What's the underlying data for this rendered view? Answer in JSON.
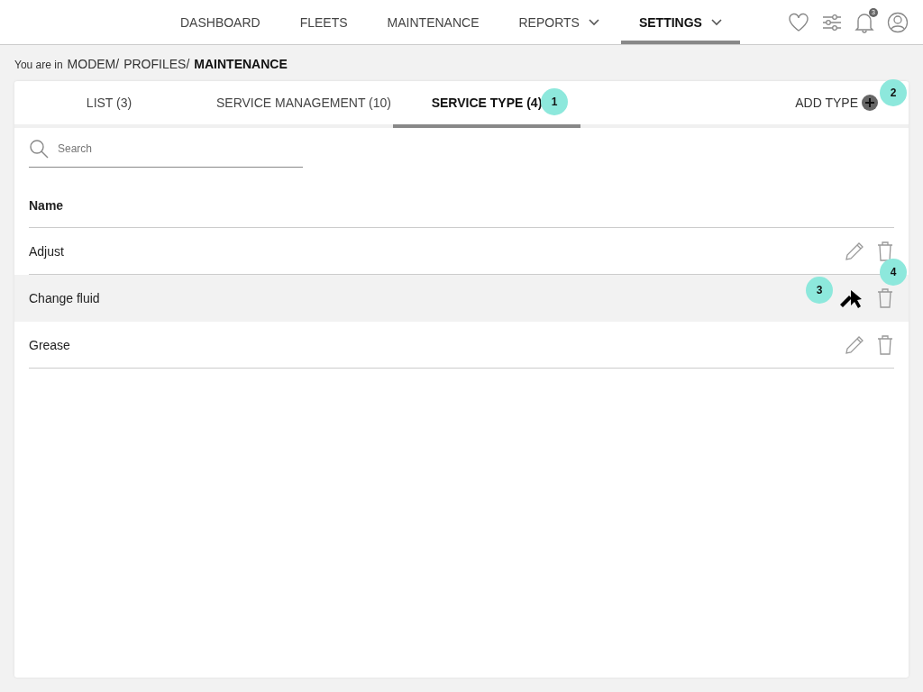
{
  "nav": {
    "items": [
      {
        "label": "DASHBOARD",
        "selected": false,
        "dropdown": false
      },
      {
        "label": "FLEETS",
        "selected": false,
        "dropdown": false
      },
      {
        "label": "MAINTENANCE",
        "selected": false,
        "dropdown": false
      },
      {
        "label": "REPORTS",
        "selected": false,
        "dropdown": true
      },
      {
        "label": "SETTINGS",
        "selected": true,
        "dropdown": true
      }
    ],
    "notification_count": "3"
  },
  "breadcrumb": {
    "prefix": "You are in",
    "path": [
      "MODEM/",
      "PROFILES/",
      "MAINTENANCE"
    ]
  },
  "tabs": [
    {
      "label": "LIST (3)",
      "selected": false
    },
    {
      "label": "SERVICE MANAGEMENT (10)",
      "selected": false
    },
    {
      "label": "SERVICE TYPE (4)",
      "selected": true,
      "callout": "1"
    }
  ],
  "add_type": {
    "label": "ADD TYPE",
    "callout": "2"
  },
  "search": {
    "placeholder": "Search"
  },
  "table": {
    "columns": [
      "Name"
    ],
    "rows": [
      {
        "name": "Adjust",
        "hovered": false
      },
      {
        "name": "Change fluid",
        "hovered": true,
        "edit_callout": "3",
        "delete_callout": "4"
      },
      {
        "name": "Grease",
        "hovered": false
      }
    ]
  }
}
